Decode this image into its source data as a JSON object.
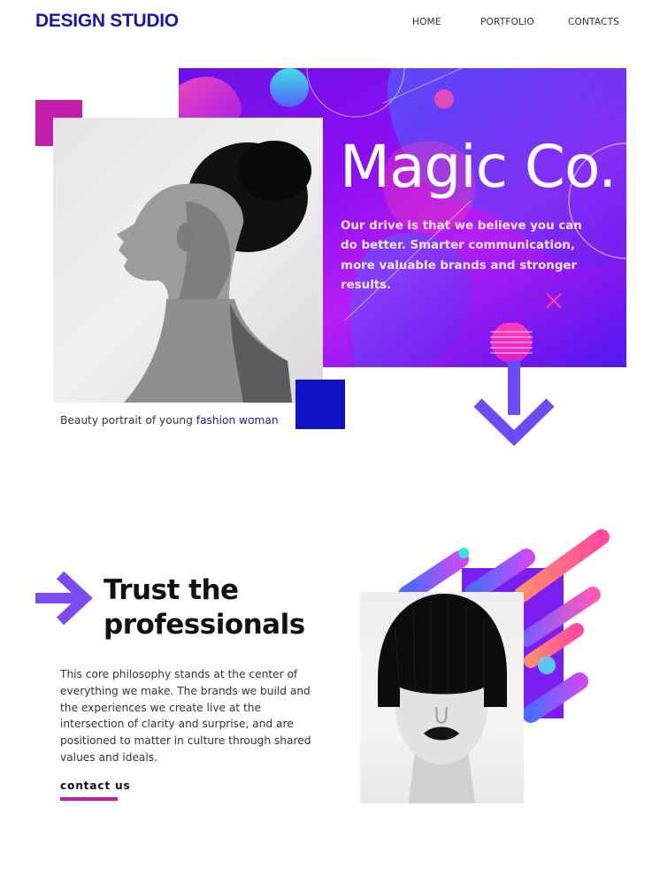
{
  "header": {
    "logo": "DESIGN STUDIO",
    "nav": [
      {
        "label": "HOME"
      },
      {
        "label": "PORTFOLIO"
      },
      {
        "label": "CONTACTS"
      }
    ]
  },
  "hero": {
    "title": "Magic Co.",
    "text": "Our drive is that we believe you can do better. Smarter communication, more valuable brands and stronger results.",
    "caption_text": "Beauty portrait of young ",
    "caption_link": "fashion woman"
  },
  "trust": {
    "heading": "Trust the professionals",
    "text": "This core philosophy stands at the center of everything we make. The brands we build and the experiences we create live at the intersection of clarity and surprise, and are positioned to matter in culture through shared values and ideals.",
    "cta": "contact us"
  },
  "colors": {
    "brand": "#1b17a6",
    "magenta": "#c21ea9",
    "violet": "#6b4cf5",
    "deep_blue": "#1110c4"
  },
  "icons": [
    "arrow-down-icon",
    "arrow-right-icon"
  ]
}
